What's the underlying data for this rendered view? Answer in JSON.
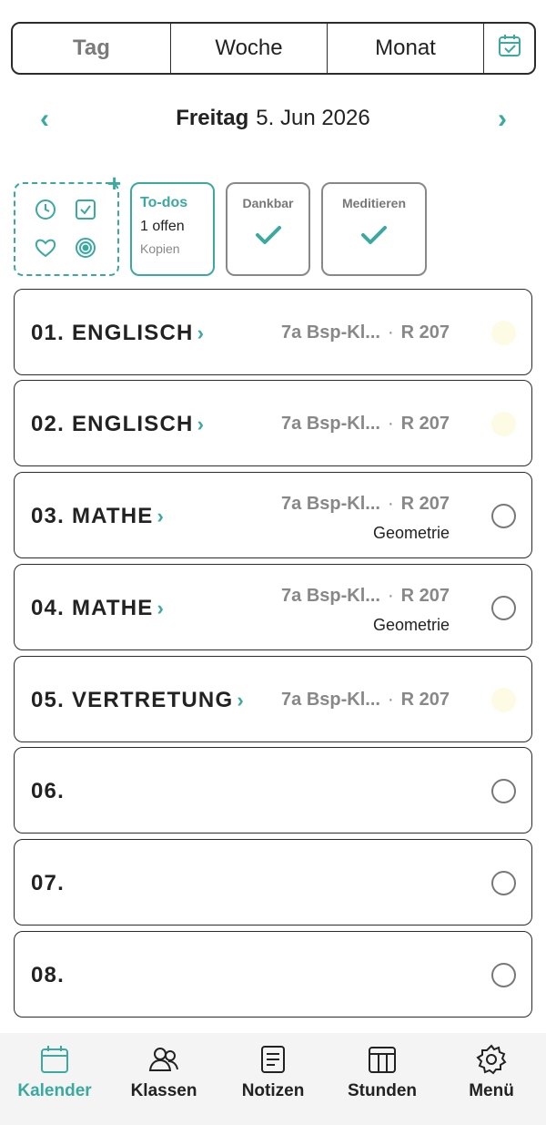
{
  "view_switcher": {
    "day": "Tag",
    "week": "Woche",
    "month": "Monat",
    "calendar_icon": "calendar-check-icon"
  },
  "date_nav": {
    "prev": "‹",
    "next": "›",
    "weekday": "Freitag",
    "date": "5. Jun 2026"
  },
  "quick_add": {
    "plus": "+",
    "icons": [
      "clock-icon",
      "checkbox-icon",
      "heart-icon",
      "target-icon"
    ]
  },
  "todos": {
    "title": "To-dos",
    "open": "1 offen",
    "sub": "Kopien"
  },
  "habits": [
    {
      "label": "Dankbar",
      "done": true
    },
    {
      "label": "Meditieren",
      "done": true
    }
  ],
  "lessons": [
    {
      "num": "01.",
      "subject": "ENGLISCH",
      "chevron": "›",
      "class": "7a Bsp-Kl...",
      "sep": "·",
      "room": "R 207",
      "topic": "",
      "status": "soft"
    },
    {
      "num": "02.",
      "subject": "ENGLISCH",
      "chevron": "›",
      "class": "7a Bsp-Kl...",
      "sep": "·",
      "room": "R 207",
      "topic": "",
      "status": "soft"
    },
    {
      "num": "03.",
      "subject": "MATHE",
      "chevron": "›",
      "class": "7a Bsp-Kl...",
      "sep": "·",
      "room": "R 207",
      "topic": "Geometrie",
      "status": "open"
    },
    {
      "num": "04.",
      "subject": "MATHE",
      "chevron": "›",
      "class": "7a Bsp-Kl...",
      "sep": "·",
      "room": "R 207",
      "topic": "Geometrie",
      "status": "open"
    },
    {
      "num": "05.",
      "subject": "VERTRETUNG",
      "chevron": "›",
      "class": "7a Bsp-Kl...",
      "sep": "·",
      "room": "R 207",
      "topic": "",
      "status": "soft"
    },
    {
      "num": "06.",
      "subject": "",
      "chevron": "",
      "class": "",
      "sep": "",
      "room": "",
      "topic": "",
      "status": "open"
    },
    {
      "num": "07.",
      "subject": "",
      "chevron": "",
      "class": "",
      "sep": "",
      "room": "",
      "topic": "",
      "status": "open"
    },
    {
      "num": "08.",
      "subject": "",
      "chevron": "",
      "class": "",
      "sep": "",
      "room": "",
      "topic": "",
      "status": "open"
    }
  ],
  "bottom_nav": [
    {
      "label": "Kalender",
      "icon": "calendar-icon",
      "active": true
    },
    {
      "label": "Klassen",
      "icon": "users-icon",
      "active": false
    },
    {
      "label": "Notizen",
      "icon": "notes-icon",
      "active": false
    },
    {
      "label": "Stunden",
      "icon": "timetable-icon",
      "active": false
    },
    {
      "label": "Menü",
      "icon": "gear-icon",
      "active": false
    }
  ],
  "colors": {
    "accent": "#3aa99f",
    "border": "#2b2b2b",
    "muted": "#888888",
    "soft_status": "#fdfbe3"
  }
}
